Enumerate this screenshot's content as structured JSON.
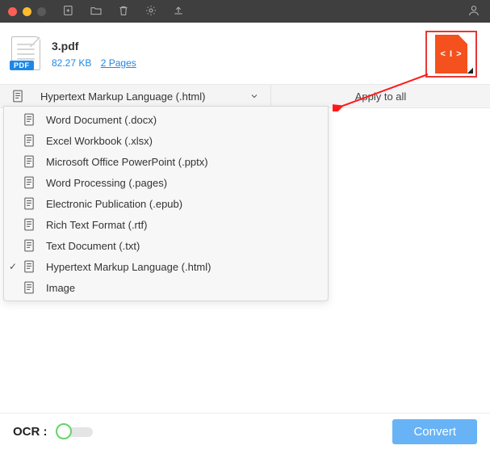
{
  "colors": {
    "accent": "#1e88e5",
    "danger": "#e53935",
    "convert": "#68b3f5",
    "output": "#f4511e"
  },
  "titlebar": {
    "traffic": [
      "#ff5f57",
      "#febc2e",
      "#5a5a5a"
    ]
  },
  "file": {
    "name": "3.pdf",
    "size": "82.27 KB",
    "pages": "2 Pages",
    "badge": "PDF",
    "output_icon_code": "< I >"
  },
  "formatbar": {
    "selected": "Hypertext Markup Language (.html)",
    "apply_label": "Apply to all"
  },
  "dropdown": [
    {
      "label": "Word Document (.docx)",
      "selected": false
    },
    {
      "label": "Excel Workbook (.xlsx)",
      "selected": false
    },
    {
      "label": "Microsoft Office PowerPoint (.pptx)",
      "selected": false
    },
    {
      "label": "Word Processing (.pages)",
      "selected": false
    },
    {
      "label": "Electronic Publication (.epub)",
      "selected": false
    },
    {
      "label": "Rich Text Format (.rtf)",
      "selected": false
    },
    {
      "label": "Text Document (.txt)",
      "selected": false
    },
    {
      "label": "Hypertext Markup Language (.html)",
      "selected": true
    },
    {
      "label": "Image",
      "selected": false
    }
  ],
  "bottom": {
    "ocr_label": "OCR :",
    "ocr_on": false,
    "convert_label": "Convert"
  }
}
